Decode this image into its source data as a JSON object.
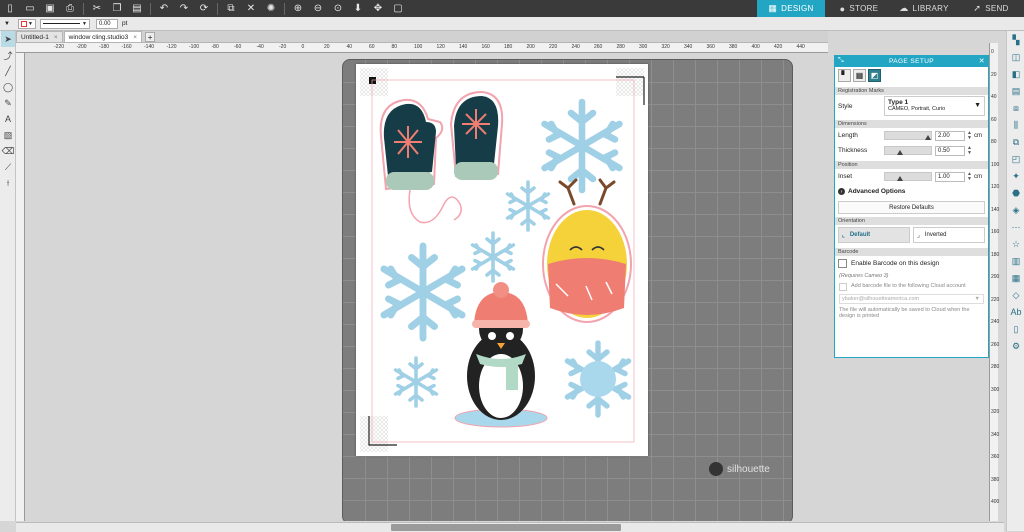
{
  "toolbar": {
    "icons": [
      "new-file-icon",
      "open-icon",
      "save-icon",
      "print-icon",
      "cut-icon",
      "copy-icon",
      "paste-icon",
      "undo-icon",
      "redo-icon",
      "refresh-icon",
      "trace-icon",
      "delete-icon",
      "wand-icon",
      "zoom-in-icon",
      "zoom-out-icon",
      "zoom-fit-icon",
      "move-down-icon",
      "pan-icon",
      "fit-page-icon"
    ]
  },
  "nav": {
    "design": "DESIGN",
    "store": "STORE",
    "library": "LIBRARY",
    "send": "SEND"
  },
  "props": {
    "line_width": "0.00",
    "line_unit": "pt"
  },
  "tabs": [
    {
      "label": "Untitled-1"
    },
    {
      "label": "window cling.studio3"
    }
  ],
  "ruler": {
    "top": [
      "-220",
      "-200",
      "-180",
      "-160",
      "-140",
      "-120",
      "-100",
      "-80",
      "-60",
      "-40",
      "-20",
      "0",
      "20",
      "40",
      "60",
      "80",
      "100",
      "120",
      "140",
      "160",
      "180",
      "200",
      "220",
      "240",
      "260",
      "280",
      "300",
      "320",
      "340",
      "360",
      "380",
      "400",
      "420",
      "440"
    ],
    "right": [
      "0",
      "20",
      "40",
      "60",
      "80",
      "100",
      "120",
      "140",
      "160",
      "180",
      "200",
      "220",
      "240",
      "260",
      "280",
      "300",
      "320",
      "340",
      "360",
      "380",
      "400",
      "420",
      "440"
    ]
  },
  "brand": "silhouette",
  "panel": {
    "title": "PAGE SETUP",
    "registration": {
      "section": "Registration Marks",
      "style_label": "Style",
      "style_value": "Type 1",
      "style_sub": "CAMEO, Portrait, Curio"
    },
    "dimensions": {
      "section": "Dimensions",
      "length_label": "Length",
      "length_value": "2.00",
      "thickness_label": "Thickness",
      "thickness_value": "0.50",
      "unit": "cm",
      "length_slider_fraction": 0.95,
      "thickness_slider_fraction": 0.28
    },
    "position": {
      "section": "Position",
      "inset_label": "Inset",
      "inset_value": "1.00",
      "inset_slider_fraction": 0.28
    },
    "advanced": "Advanced Options",
    "restore": "Restore Defaults",
    "orientation": {
      "section": "Orientation",
      "default": "Default",
      "inverted": "Inverted"
    },
    "barcode": {
      "section": "Barcode",
      "enable": "Enable Barcode on this design",
      "requires": "(Requires Cameo 3)",
      "add_file": "Add barcode file to the following Cloud account",
      "account": "ybaker@silhouetteamerica.com",
      "note": "The file will automatically be saved to Cloud when the design is printed"
    }
  },
  "colors": {
    "accent": "#23a6c4",
    "mitten": "#18404a",
    "pink": "#ef7d72",
    "ice": "#a9d8ec",
    "yellow": "#f5d13a"
  }
}
